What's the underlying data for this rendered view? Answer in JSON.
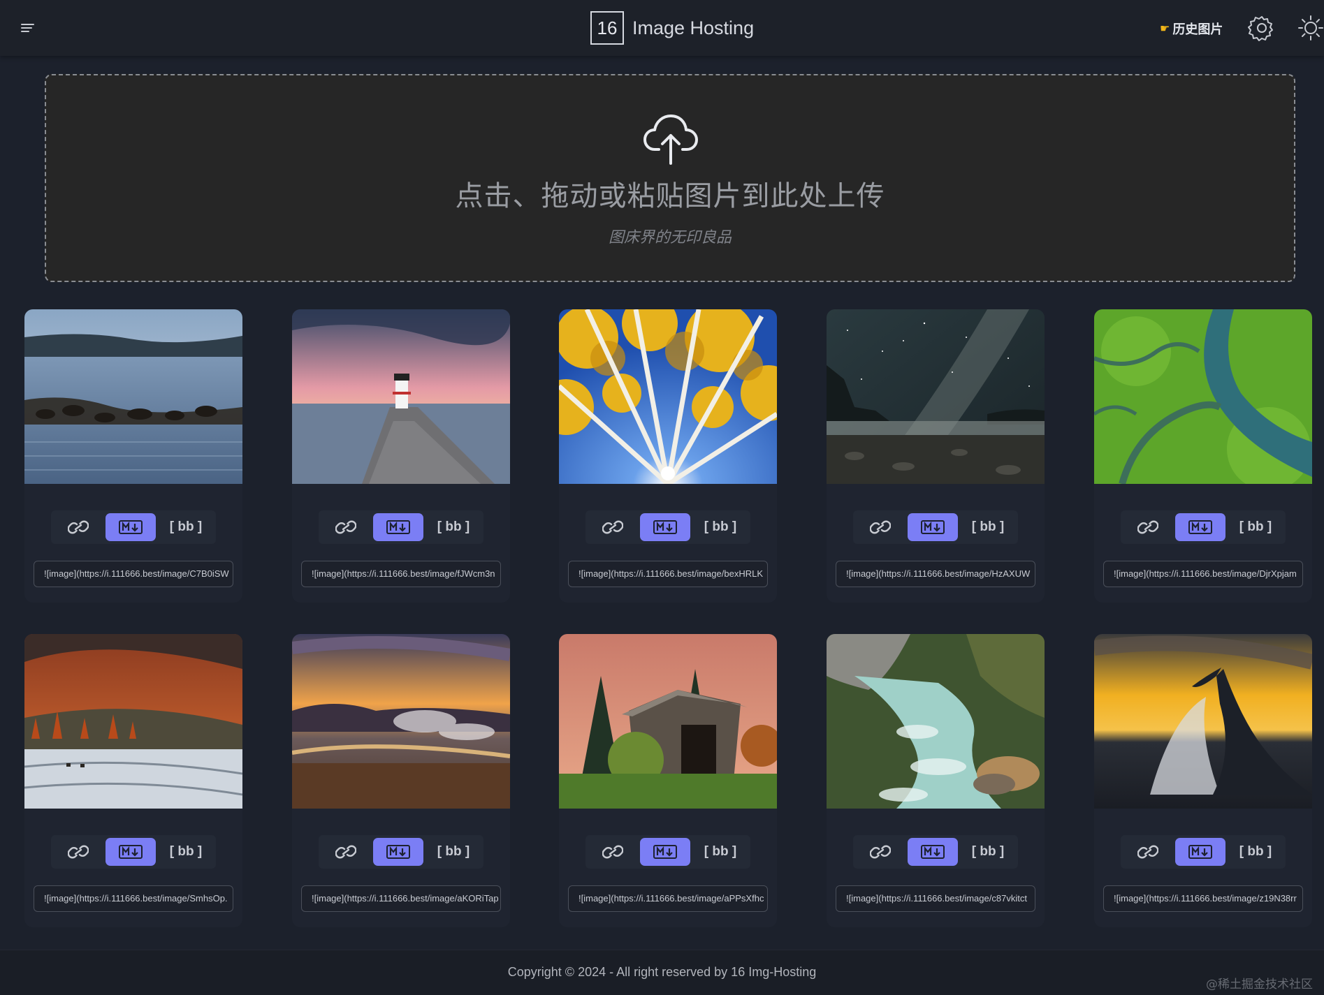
{
  "header": {
    "logo_text": "16",
    "app_name": "Image Hosting",
    "history_label": "历史图片",
    "history_icon": "pointing-hand-icon"
  },
  "upload": {
    "title": "点击、拖动或粘贴图片到此处上传",
    "subtitle": "图床界的无印良品"
  },
  "card_buttons": {
    "link_icon": "link-icon",
    "markdown_icon": "markdown-icon",
    "bb_label": "[ bb ]"
  },
  "images": [
    {
      "scene": "sea-lions-lake",
      "url": "![image](https://i.111666.best/image/C7B0iSW"
    },
    {
      "scene": "lighthouse-sunset",
      "url": "![image](https://i.111666.best/image/fJWcm3n"
    },
    {
      "scene": "aspen-forest",
      "url": "![image](https://i.111666.best/image/bexHRLK"
    },
    {
      "scene": "milky-way-coast",
      "url": "![image](https://i.111666.best/image/HzAXUW"
    },
    {
      "scene": "green-river-delta",
      "url": "![image](https://i.111666.best/image/DjrXpjam"
    },
    {
      "scene": "autumn-tundra",
      "url": "![image](https://i.111666.best/image/SmhsOp."
    },
    {
      "scene": "geyser-basin-sunset",
      "url": "![image](https://i.111666.best/image/aKORiTap"
    },
    {
      "scene": "covered-bridge",
      "url": "![image](https://i.111666.best/image/aPPsXfhc"
    },
    {
      "scene": "mountain-creek",
      "url": "![image](https://i.111666.best/image/c87vkitct"
    },
    {
      "scene": "whale-tail-sunset",
      "url": "![image](https://i.111666.best/image/z19N38rr"
    }
  ],
  "footer": {
    "copyright": "Copyright © 2024 - All right reserved by 16 Img-Hosting"
  },
  "watermark": "@稀土掘金技术社区",
  "colors": {
    "accent": "#7b7ef5",
    "background": "#1c212c",
    "card": "#1f2430"
  }
}
